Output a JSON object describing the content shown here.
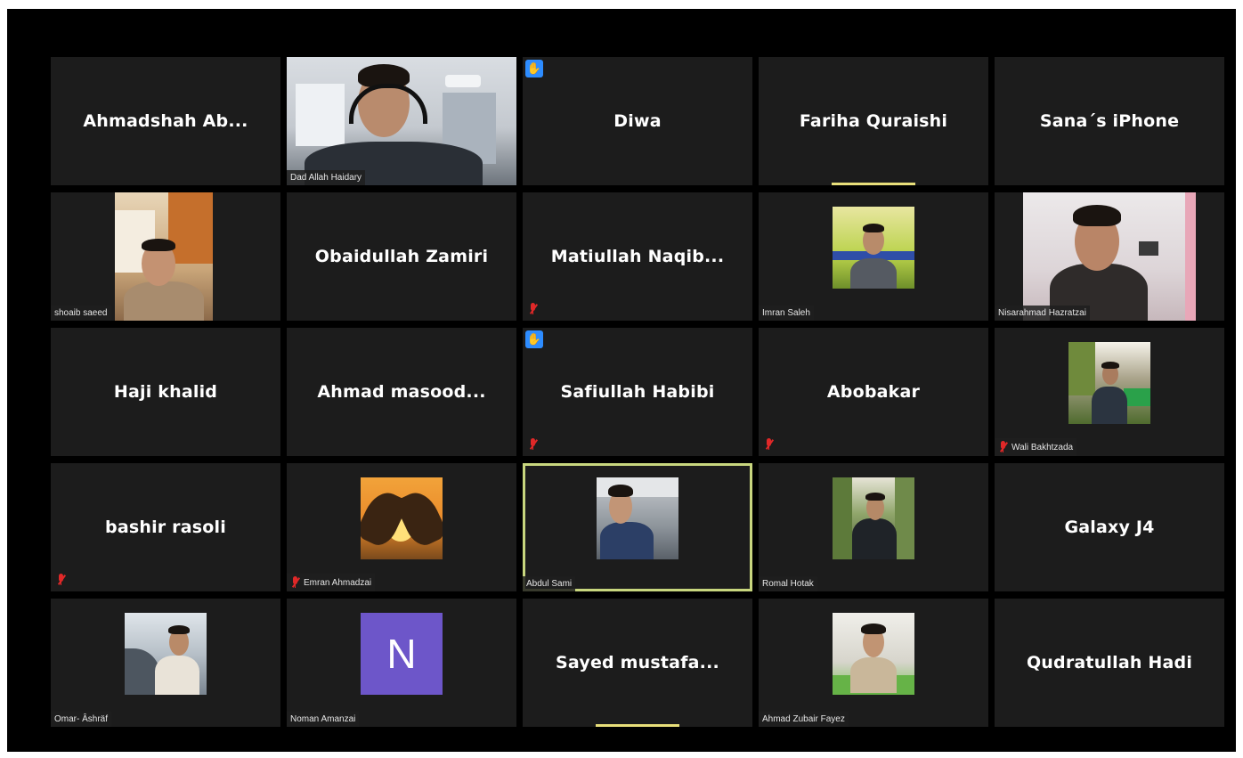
{
  "colors": {
    "tile_bg": "#1c1c1c",
    "active_border": "#c8d67e",
    "speaker_bar": "#e8df7a",
    "raise_hand": "#2d8cff",
    "muted_mic": "#e02828",
    "avatar_bg": "#6d56c9"
  },
  "participants": [
    {
      "name": "Ahmadshah  Ab...",
      "kind": "name-only"
    },
    {
      "name": "Dad Allah Haidary",
      "kind": "video"
    },
    {
      "name": "Diwa",
      "kind": "name-only",
      "hand_raised": true
    },
    {
      "name": "Fariha Quraishi",
      "kind": "name-only",
      "speaking": true
    },
    {
      "name": "Sana´s iPhone",
      "kind": "name-only"
    },
    {
      "name": "shoaib saeed",
      "kind": "video"
    },
    {
      "name": "Obaidullah Zamiri",
      "kind": "name-only"
    },
    {
      "name": "Matiullah  Naqib...",
      "kind": "name-only",
      "muted": true
    },
    {
      "name": "Imran Saleh",
      "kind": "photo"
    },
    {
      "name": "Nisarahmad Hazratzai",
      "kind": "video"
    },
    {
      "name": "Haji khalid",
      "kind": "name-only"
    },
    {
      "name": "Ahmad  masood...",
      "kind": "name-only"
    },
    {
      "name": "Safiullah Habibi",
      "kind": "name-only",
      "hand_raised": true,
      "muted": true
    },
    {
      "name": "Abobakar",
      "kind": "name-only",
      "muted": true
    },
    {
      "name": "Wali Bakhtzada",
      "kind": "photo",
      "muted": true
    },
    {
      "name": "bashir rasoli",
      "kind": "name-only",
      "muted": true
    },
    {
      "name": "Emran Ahmadzai",
      "kind": "photo",
      "muted": true
    },
    {
      "name": "Abdul Sami",
      "kind": "photo",
      "active": true
    },
    {
      "name": "Romal Hotak",
      "kind": "photo"
    },
    {
      "name": "Galaxy J4",
      "kind": "name-only"
    },
    {
      "name": "Omar- Âshräf",
      "kind": "photo"
    },
    {
      "name": "Noman Amanzai",
      "kind": "avatar",
      "initial": "N"
    },
    {
      "name": "Sayed  mustafa...",
      "kind": "name-only",
      "speaking": true
    },
    {
      "name": "Ahmad Zubair Fayez",
      "kind": "photo"
    },
    {
      "name": "Qudratullah Hadi",
      "kind": "name-only"
    }
  ]
}
